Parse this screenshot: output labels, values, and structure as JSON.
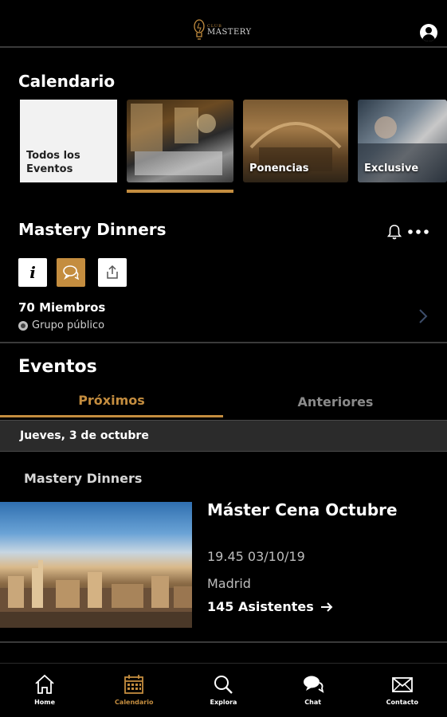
{
  "header": {
    "logo_small": "CLUB",
    "logo_main": "MASTERY"
  },
  "calendar": {
    "title": "Calendario",
    "cards": [
      {
        "label": "Todos los Eventos"
      },
      {
        "label": ""
      },
      {
        "label": "Ponencias"
      },
      {
        "label": "Exclusive"
      }
    ]
  },
  "group": {
    "title": "Mastery Dinners",
    "members": "70 Miembros",
    "visibility": "Grupo público"
  },
  "events": {
    "title": "Eventos",
    "tabs": [
      {
        "label": "Próximos",
        "active": true
      },
      {
        "label": "Anteriores",
        "active": false
      }
    ],
    "date_header": "Jueves, 3 de octubre",
    "group_label": "Mastery Dinners",
    "items": [
      {
        "title": "Máster Cena Octubre",
        "datetime": "19.45  03/10/19",
        "location": "Madrid",
        "attendees": "145 Asistentes"
      }
    ]
  },
  "nav": {
    "items": [
      {
        "label": "Home",
        "icon": "home-icon"
      },
      {
        "label": "Calendario",
        "icon": "calendar-icon",
        "active": true
      },
      {
        "label": "Explora",
        "icon": "search-icon"
      },
      {
        "label": "Chat",
        "icon": "chat-icon"
      },
      {
        "label": "Contacto",
        "icon": "envelope-icon"
      }
    ]
  },
  "colors": {
    "accent": "#c48d3f",
    "background": "#000000",
    "date_bar": "#2b2b2b"
  }
}
